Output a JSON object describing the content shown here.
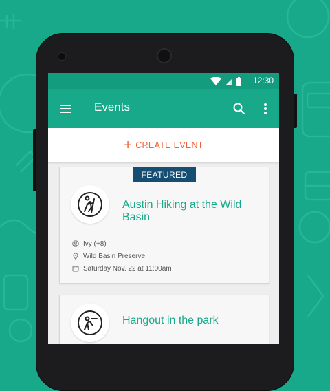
{
  "status_bar": {
    "time": "12:30",
    "icons": [
      "wifi-icon",
      "signal-icon",
      "battery-icon"
    ]
  },
  "app_bar": {
    "title": "Events",
    "icons": [
      "menu-icon",
      "search-icon",
      "more-vert-icon"
    ]
  },
  "create_button": {
    "plus": "+",
    "label": "CREATE EVENT"
  },
  "events": [
    {
      "badge": "FEATURED",
      "title": "Austin Hiking at the Wild Basin",
      "icon": "hiker-icon",
      "attendees": "Ivy (+8)",
      "location": "Wild Basin Preserve",
      "datetime": "Saturday Nov. 22 at 11:00am"
    },
    {
      "title": "Hangout in the park",
      "icon": "park-icon"
    }
  ],
  "colors": {
    "primary": "#17a98a",
    "status_bar": "#149c7e",
    "accent": "#f0623a",
    "badge": "#164d72"
  }
}
